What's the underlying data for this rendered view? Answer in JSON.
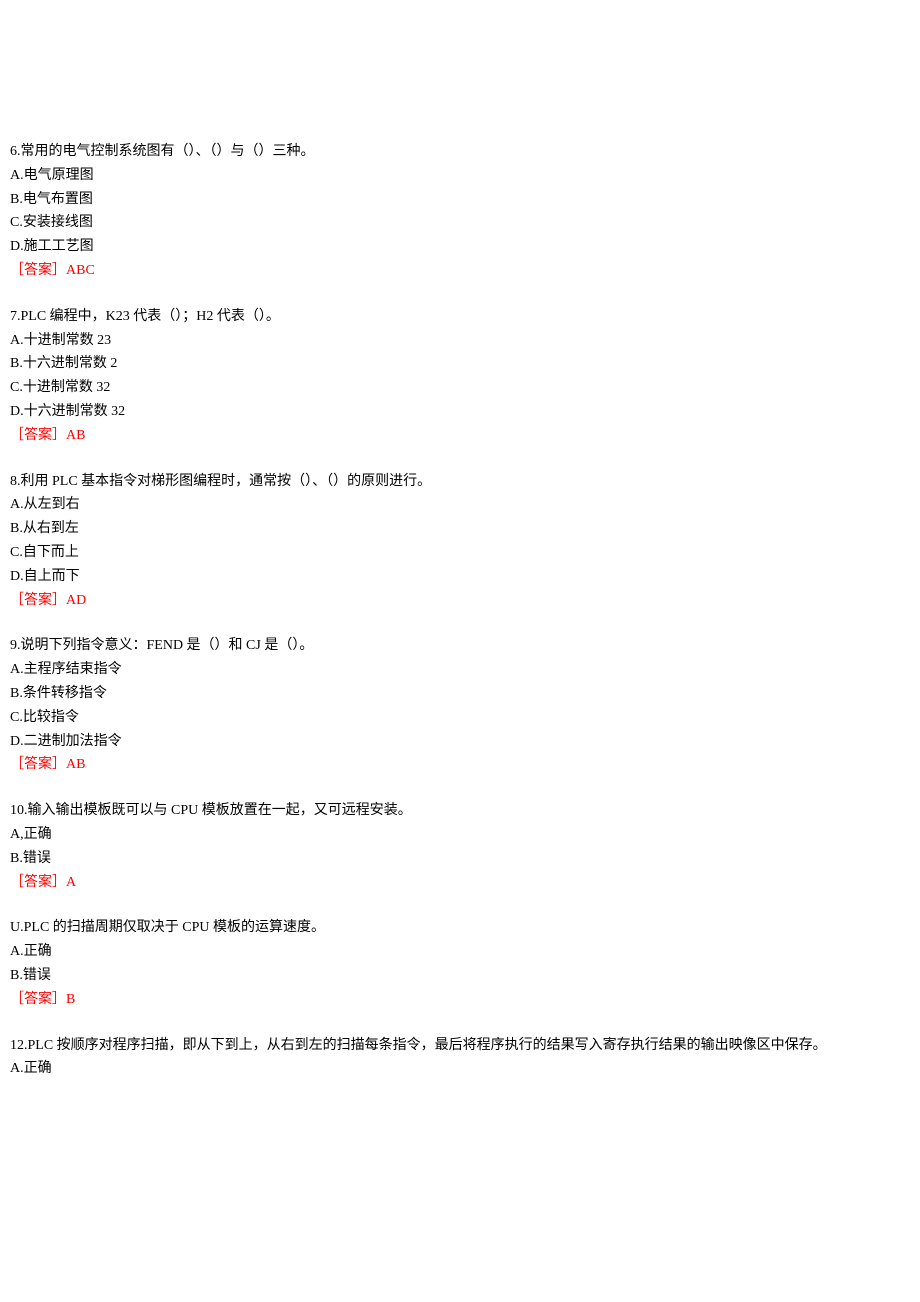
{
  "questions": [
    {
      "number": "6",
      "text": "常用的电气控制系统图有（）、（）与（）三种。",
      "options": [
        {
          "label": "A",
          "text": "电气原理图"
        },
        {
          "label": "B",
          "text": "电气布置图"
        },
        {
          "label": "C",
          "text": "安装接线图"
        },
        {
          "label": "D",
          "text": "施工工艺图"
        }
      ],
      "answerLabel": "［答案］",
      "answer": "ABC"
    },
    {
      "number": "7",
      "text": "PLC 编程中，K23 代表（）；H2 代表（）。",
      "options": [
        {
          "label": "A",
          "text": "十进制常数 23"
        },
        {
          "label": "B",
          "text": "十六进制常数 2"
        },
        {
          "label": "C",
          "text": "十进制常数 32"
        },
        {
          "label": "D",
          "text": "十六进制常数 32"
        }
      ],
      "answerLabel": "［答案］",
      "answer": "AB"
    },
    {
      "number": "8",
      "text": "利用 PLC 基本指令对梯形图编程时，通常按（）、（）的原则进行。",
      "options": [
        {
          "label": "A",
          "text": "从左到右"
        },
        {
          "label": "B",
          "text": "从右到左"
        },
        {
          "label": "C",
          "text": "自下而上"
        },
        {
          "label": "D",
          "text": "自上而下"
        }
      ],
      "answerLabel": "［答案］",
      "answer": "AD"
    },
    {
      "number": "9",
      "text": "说明下列指令意义：FEND 是（）和 CJ 是（）。",
      "options": [
        {
          "label": "A",
          "text": "主程序结束指令"
        },
        {
          "label": "B",
          "text": "条件转移指令"
        },
        {
          "label": "C",
          "text": "比较指令"
        },
        {
          "label": "D",
          "text": "二进制加法指令"
        }
      ],
      "answerLabel": "［答案］",
      "answer": "AB"
    },
    {
      "number": "10",
      "text": "输入输出模板既可以与 CPU 模板放置在一起，又可远程安装。",
      "options": [
        {
          "label": "A",
          "sep": ",",
          "text": "正确"
        },
        {
          "label": "B",
          "text": "错误"
        }
      ],
      "answerLabel": "［答案］",
      "answer": "A"
    },
    {
      "number": "U",
      "text": "PLC 的扫描周期仅取决于 CPU 模板的运算速度。",
      "options": [
        {
          "label": "A",
          "text": "正确"
        },
        {
          "label": "B",
          "text": "错误"
        }
      ],
      "answerLabel": "［答案］",
      "answer": "B"
    },
    {
      "number": "12",
      "text": "PLC 按顺序对程序扫描，即从下到上，从右到左的扫描每条指令，最后将程序执行的结果写入寄存执行结果的输出映像区中保存。",
      "options": [
        {
          "label": "A",
          "text": "正确"
        }
      ],
      "answerLabel": "",
      "answer": ""
    }
  ]
}
